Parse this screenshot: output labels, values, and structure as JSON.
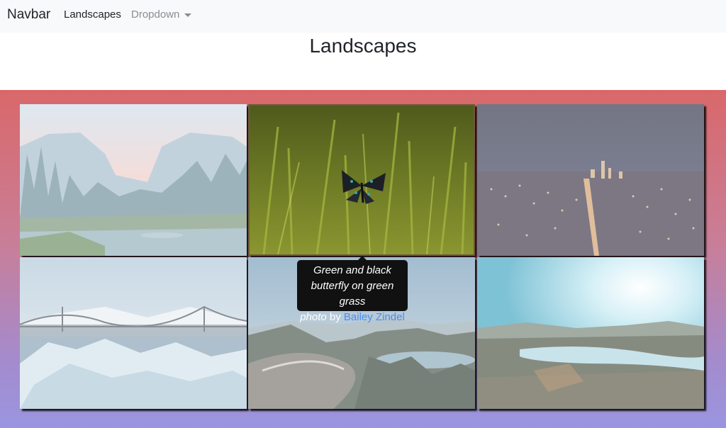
{
  "navbar": {
    "brand": "Navbar",
    "links": [
      {
        "label": "Landscapes",
        "active": true
      },
      {
        "label": "Dropdown",
        "has_caret": true
      }
    ]
  },
  "page": {
    "title": "Landscapes"
  },
  "gallery": {
    "background_colors": [
      "#d9686a",
      "#9a95e0"
    ],
    "images": [
      {
        "subject": "mountain valley with pine trees and river",
        "focused": false
      },
      {
        "subject": "green and black butterfly on green grass",
        "focused": true
      },
      {
        "subject": "city lights at night from above",
        "focused": false
      },
      {
        "subject": "ice chunks on shore with suspension bridge",
        "focused": false
      },
      {
        "subject": "winding road through forest and lake",
        "focused": false
      },
      {
        "subject": "sunlit lake valley with hills",
        "focused": false
      }
    ]
  },
  "tooltip": {
    "line1": "Green and black",
    "line2": "butterfly on green grass",
    "line3_prefix": "photo",
    "line3_by": "by",
    "author": "Bailey Zindel",
    "author_color": "#4d8df6"
  }
}
